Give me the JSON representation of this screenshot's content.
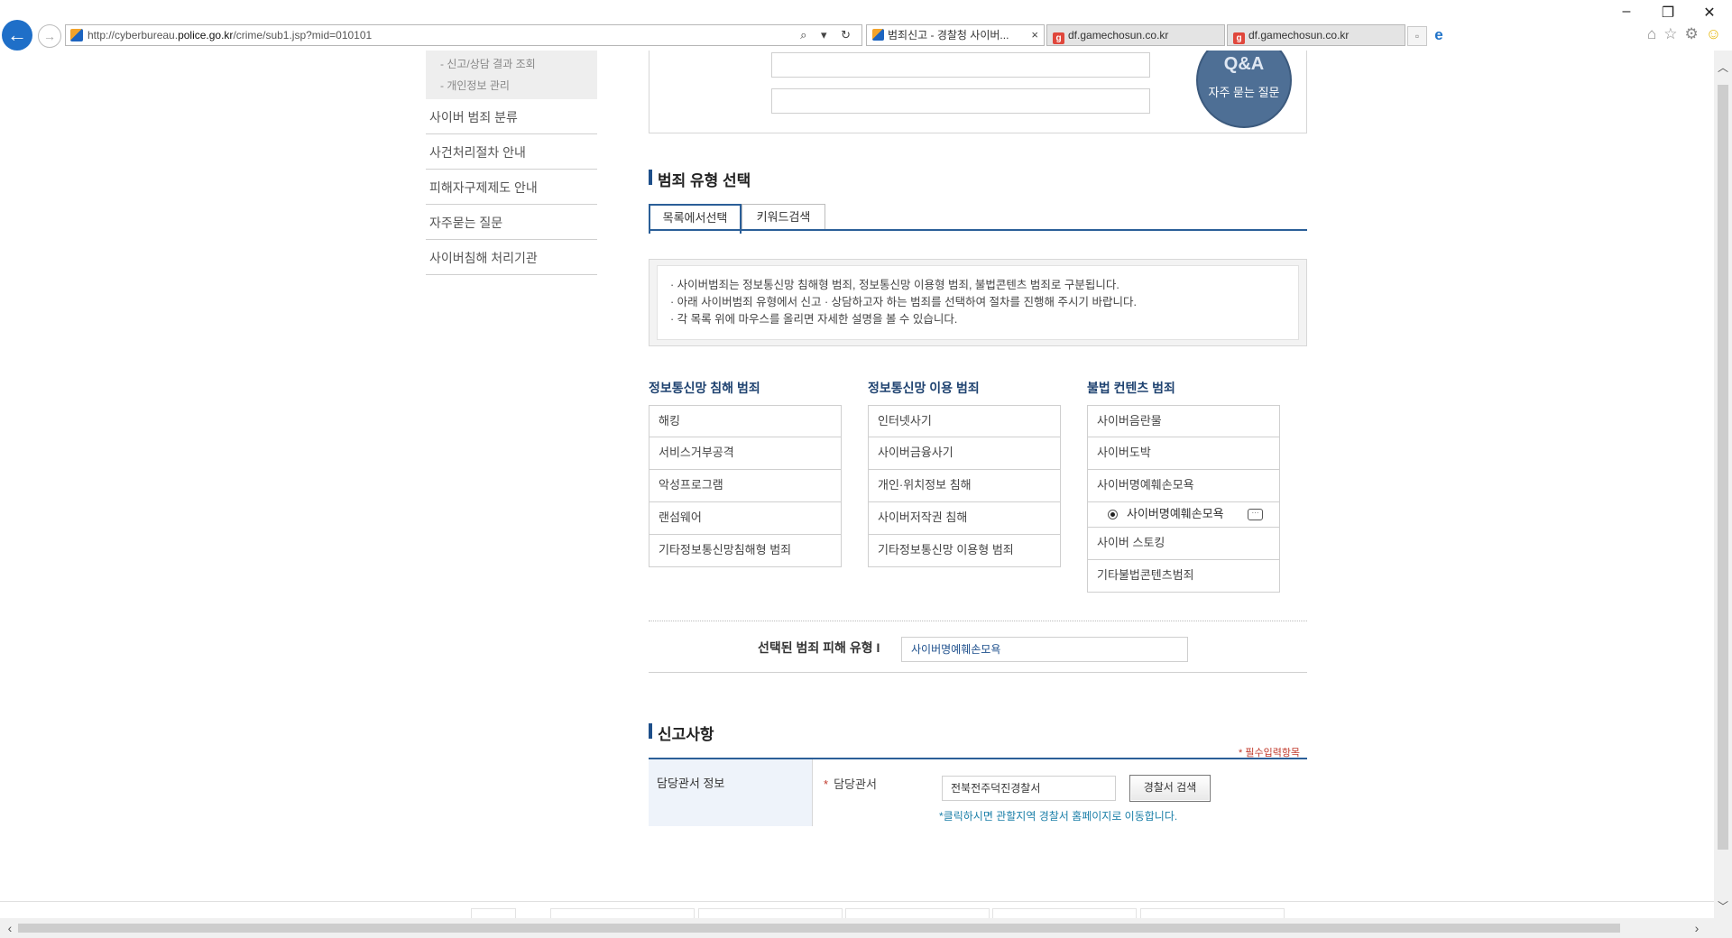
{
  "browser": {
    "address_host_prefix": "http://cyberbureau.",
    "address_host": "police.go.kr",
    "address_path": "/crime/sub1.jsp?mid=010101",
    "address_tools": "⌕ ▾ ↻",
    "tabs": [
      {
        "label": "범죄신고 - 경찰청 사이버...",
        "close": "×"
      },
      {
        "label": "df.gamechosun.co.kr"
      },
      {
        "label": "df.gamechosun.co.kr"
      }
    ],
    "window_controls": {
      "minimize": "–",
      "restore": "❐",
      "close": "✕"
    }
  },
  "sidebar": {
    "sub_items": [
      "- 신고/상담 결과 조회",
      "- 개인정보 관리"
    ],
    "items": [
      "사이버 범죄 분류",
      "사건처리절차 안내",
      "피해자구제제도 안내",
      "자주묻는 질문",
      "사이버침해 처리기관"
    ]
  },
  "qa_badge": {
    "big": "Q&A",
    "small": "자주 묻는 질문"
  },
  "crime_type": {
    "title": "범죄 유형 선택",
    "tabs": [
      "목록에서선택",
      "키워드검색"
    ],
    "notice": [
      "· 사이버범죄는 정보통신망 침해형 범죄, 정보통신망 이용형 범죄, 불법콘텐츠 범죄로 구분됩니다.",
      "· 아래 사이버범죄 유형에서 신고 · 상담하고자 하는 범죄를 선택하여 절차를 진행해 주시기 바랍니다.",
      "· 각 목록 위에 마우스를 올리면 자세한 설명을 볼 수 있습니다."
    ],
    "columns": [
      {
        "heading": "정보통신망 침해 범죄",
        "items": [
          "해킹",
          "서비스거부공격",
          "악성프로그램",
          "랜섬웨어",
          "기타정보통신망침해형 범죄"
        ]
      },
      {
        "heading": "정보통신망 이용 범죄",
        "items": [
          "인터넷사기",
          "사이버금융사기",
          "개인·위치정보 침해",
          "사이버저작권 침해",
          "기타정보통신망 이용형 범죄"
        ]
      },
      {
        "heading": "불법 컨텐츠 범죄",
        "items": [
          "사이버음란물",
          "사이버도박",
          "사이버명예훼손모욕",
          "사이버 스토킹",
          "기타불법콘텐츠범죄"
        ]
      }
    ],
    "selected_sub_item": "사이버명예훼손모욕",
    "selected_label": "선택된 범죄 피해 유형 I",
    "selected_value": "사이버명예훼손모욕"
  },
  "report": {
    "title": "신고사항",
    "required_note": "* 필수입력항목",
    "row_label": "담당관서 정보",
    "field_label": "담당관서",
    "field_required_mark": "*",
    "police_station_value": "전북전주덕진경찰서",
    "search_button": "경찰서 검색",
    "link_text": "*클릭하시면 관할지역 경찰서 홈페이지로 이동합니다."
  },
  "colors": {
    "accent": "#2b5f98",
    "heading_blue": "#1e4270",
    "required_red": "#c0392b",
    "link": "#1b7fa8"
  }
}
